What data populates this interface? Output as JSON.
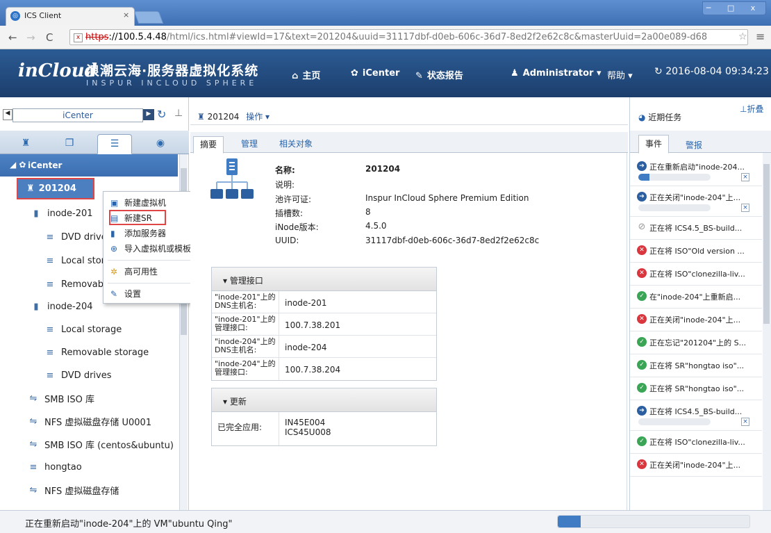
{
  "browser": {
    "tab_title": "ICS Client",
    "tab_close": "×",
    "url_scheme": "https",
    "url_host": "://100.5.4.48",
    "url_rest": "/html/ics.html#viewId=17&text=201204&uuid=31117dbf-d0eb-606c-36d7-8ed2f2e62c8c&masterUuid=2a00e089-d68",
    "window_controls": "─ □ x"
  },
  "app": {
    "logo": "inCloud",
    "brand": "浪潮云海·服务器虚拟化系统",
    "brand_sub": "INSPUR INCLOUD SPHERE",
    "nav": {
      "home": "主页",
      "icenter": "iCenter",
      "report": "状态报告",
      "user": "Administrator",
      "help": "帮助"
    },
    "datetime": "2016-08-04 09:34:23"
  },
  "left": {
    "search_value": "iCenter",
    "root": "iCenter",
    "pool": "201204",
    "items": [
      {
        "label": "inode-201"
      },
      {
        "label": "DVD drives"
      },
      {
        "label": "Local storage"
      },
      {
        "label": "Removable storage"
      },
      {
        "label": "inode-204"
      },
      {
        "label": "Local storage"
      },
      {
        "label": "Removable storage"
      },
      {
        "label": "DVD drives"
      },
      {
        "label": "SMB ISO 库"
      },
      {
        "label": "NFS 虚拟磁盘存储 U0001"
      },
      {
        "label": "SMB ISO 库 (centos&ubuntu)"
      },
      {
        "label": "hongtao"
      },
      {
        "label": "NFS 虚拟磁盘存储"
      }
    ]
  },
  "context_menu": {
    "new_vm": "新建虚拟机",
    "new_sr": "新建SR",
    "add_server": "添加服务器",
    "import": "导入虚拟机或模板",
    "ha": "高可用性",
    "settings": "设置"
  },
  "center": {
    "title": "201204",
    "ops": "操作",
    "tabs": {
      "summary": "摘要",
      "manage": "管理",
      "related": "相关对象"
    },
    "summary": [
      {
        "k": "名称:",
        "v": "201204"
      },
      {
        "k": "说明:",
        "v": ""
      },
      {
        "k": "池许可证:",
        "v": "Inspur InCloud Sphere Premium Edition"
      },
      {
        "k": "插槽数:",
        "v": "8"
      },
      {
        "k": "iNode版本:",
        "v": "4.5.0"
      },
      {
        "k": "UUID:",
        "v": "31117dbf-d0eb-606c-36d7-8ed2f2e62c8c"
      }
    ],
    "mgmt": {
      "title": "管理接口",
      "rows": [
        {
          "k": "\"inode-201\"上的DNS主机名:",
          "v": "inode-201"
        },
        {
          "k": "\"inode-201\"上的管理接口:",
          "v": "100.7.38.201"
        },
        {
          "k": "\"inode-204\"上的DNS主机名:",
          "v": "inode-204"
        },
        {
          "k": "\"inode-204\"上的管理接口:",
          "v": "100.7.38.204"
        }
      ]
    },
    "updates": {
      "title": "更新",
      "k": "已完全应用:",
      "v1": "IN45E004",
      "v2": "ICS45U008"
    }
  },
  "right": {
    "title": "近期任务",
    "fold": "折叠",
    "tabs": {
      "events": "事件",
      "alerts": "警报"
    },
    "events": [
      {
        "text": "正在重新启动\"inode-204...",
        "color": "#2b5fa0",
        "icon": "spinner-icon",
        "progress": 0.15
      },
      {
        "text": "正在关闭\"inode-204\"上...",
        "color": "#2b5fa0",
        "icon": "spinner-icon",
        "progress": 0
      },
      {
        "text": "正在将 ICS4.5_BS-build...",
        "color": "#999999",
        "icon": "cancelled-icon"
      },
      {
        "text": "正在将 ISO\"Old version ...",
        "color": "#d9363e",
        "icon": "error-icon"
      },
      {
        "text": "正在将 ISO\"clonezilla-liv...",
        "color": "#d9363e",
        "icon": "error-icon"
      },
      {
        "text": "在\"inode-204\"上重新启...",
        "color": "#3aa655",
        "icon": "success-icon"
      },
      {
        "text": "正在关闭\"inode-204\"上...",
        "color": "#d9363e",
        "icon": "error-icon"
      },
      {
        "text": "正在忘记\"201204\"上的 S...",
        "color": "#3aa655",
        "icon": "success-icon"
      },
      {
        "text": "正在将 SR\"hongtao iso\"...",
        "color": "#3aa655",
        "icon": "success-icon"
      },
      {
        "text": "正在将 SR\"hongtao iso\"...",
        "color": "#3aa655",
        "icon": "success-icon"
      },
      {
        "text": "正在将 ICS4.5_BS-build...",
        "color": "#2b5fa0",
        "icon": "spinner-icon",
        "progress": 0
      },
      {
        "text": "正在将 ISO\"clonezilla-liv...",
        "color": "#3aa655",
        "icon": "success-icon"
      },
      {
        "text": "正在关闭\"inode-204\"上...",
        "color": "#d9363e",
        "icon": "error-icon"
      }
    ]
  },
  "status": {
    "text": "正在重新启动\"inode-204\"上的 VM\"ubuntu Qing\"",
    "progress": 0.12
  }
}
